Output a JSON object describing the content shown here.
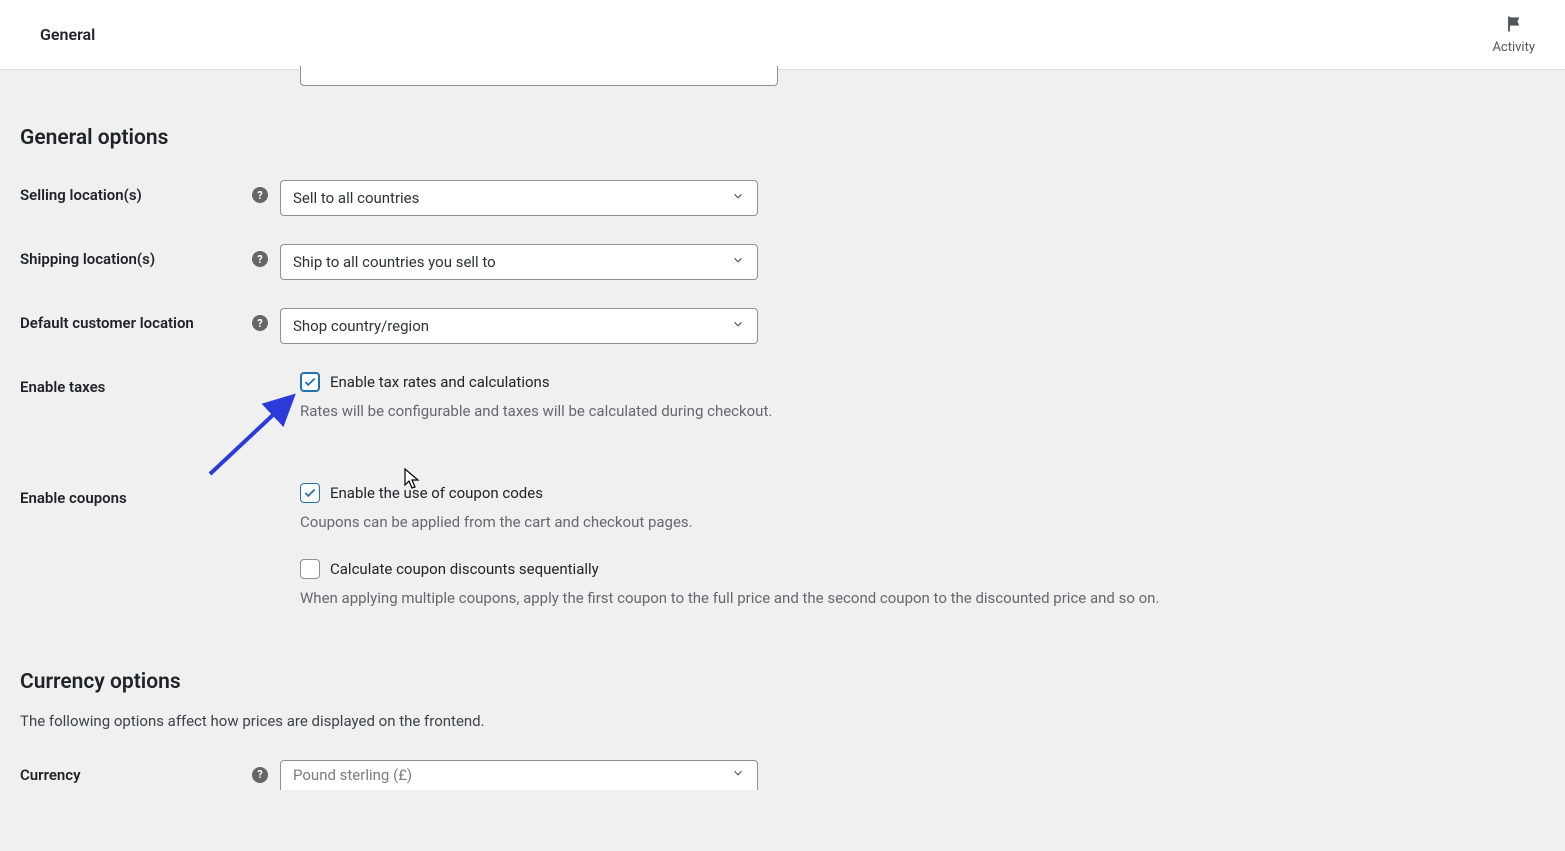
{
  "header": {
    "title": "General",
    "activity_label": "Activity"
  },
  "sections": {
    "general_options_title": "General options",
    "currency_options_title": "Currency options",
    "currency_options_desc": "The following options affect how prices are displayed on the frontend."
  },
  "fields": {
    "selling_locations": {
      "label": "Selling location(s)",
      "value": "Sell to all countries"
    },
    "shipping_locations": {
      "label": "Shipping location(s)",
      "value": "Ship to all countries you sell to"
    },
    "default_customer_location": {
      "label": "Default customer location",
      "value": "Shop country/region"
    },
    "enable_taxes": {
      "label": "Enable taxes",
      "checkbox_label": "Enable tax rates and calculations",
      "desc": "Rates will be configurable and taxes will be calculated during checkout.",
      "checked": true
    },
    "enable_coupons": {
      "label": "Enable coupons",
      "checkbox_label": "Enable the use of coupon codes",
      "desc": "Coupons can be applied from the cart and checkout pages.",
      "checked": true,
      "seq_label": "Calculate coupon discounts sequentially",
      "seq_desc": "When applying multiple coupons, apply the first coupon to the full price and the second coupon to the discounted price and so on.",
      "seq_checked": false
    },
    "currency": {
      "label": "Currency",
      "value": "Pound sterling (£)"
    }
  }
}
